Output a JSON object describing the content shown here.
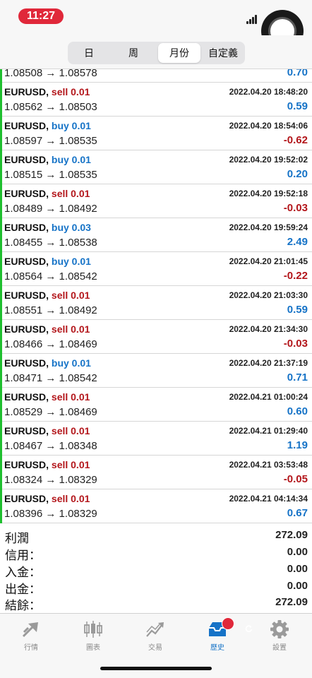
{
  "status": {
    "time": "11:27"
  },
  "segments": [
    {
      "label": "日",
      "active": false
    },
    {
      "label": "周",
      "active": false
    },
    {
      "label": "月份",
      "active": true
    },
    {
      "label": "自定義",
      "active": false
    }
  ],
  "partial_row": {
    "prices": "1.08508 → 1.08578",
    "profit": "0.70"
  },
  "deals": [
    {
      "symbol": "EURUSD,",
      "side": "sell 0.01",
      "dir": "sell",
      "date": "2022.04.20 18:48:20",
      "prices": "1.08562 → 1.08503",
      "profit": "0.59",
      "sign": "pos"
    },
    {
      "symbol": "EURUSD,",
      "side": "buy 0.01",
      "dir": "buy",
      "date": "2022.04.20 18:54:06",
      "prices": "1.08597 → 1.08535",
      "profit": "-0.62",
      "sign": "neg"
    },
    {
      "symbol": "EURUSD,",
      "side": "buy 0.01",
      "dir": "buy",
      "date": "2022.04.20 19:52:02",
      "prices": "1.08515 → 1.08535",
      "profit": "0.20",
      "sign": "pos"
    },
    {
      "symbol": "EURUSD,",
      "side": "sell 0.01",
      "dir": "sell",
      "date": "2022.04.20 19:52:18",
      "prices": "1.08489 → 1.08492",
      "profit": "-0.03",
      "sign": "neg"
    },
    {
      "symbol": "EURUSD,",
      "side": "buy 0.03",
      "dir": "buy",
      "date": "2022.04.20 19:59:24",
      "prices": "1.08455 → 1.08538",
      "profit": "2.49",
      "sign": "pos"
    },
    {
      "symbol": "EURUSD,",
      "side": "buy 0.01",
      "dir": "buy",
      "date": "2022.04.20 21:01:45",
      "prices": "1.08564 → 1.08542",
      "profit": "-0.22",
      "sign": "neg"
    },
    {
      "symbol": "EURUSD,",
      "side": "sell 0.01",
      "dir": "sell",
      "date": "2022.04.20 21:03:30",
      "prices": "1.08551 → 1.08492",
      "profit": "0.59",
      "sign": "pos"
    },
    {
      "symbol": "EURUSD,",
      "side": "sell 0.01",
      "dir": "sell",
      "date": "2022.04.20 21:34:30",
      "prices": "1.08466 → 1.08469",
      "profit": "-0.03",
      "sign": "neg"
    },
    {
      "symbol": "EURUSD,",
      "side": "buy 0.01",
      "dir": "buy",
      "date": "2022.04.20 21:37:19",
      "prices": "1.08471 → 1.08542",
      "profit": "0.71",
      "sign": "pos"
    },
    {
      "symbol": "EURUSD,",
      "side": "sell 0.01",
      "dir": "sell",
      "date": "2022.04.21 01:00:24",
      "prices": "1.08529 → 1.08469",
      "profit": "0.60",
      "sign": "pos"
    },
    {
      "symbol": "EURUSD,",
      "side": "sell 0.01",
      "dir": "sell",
      "date": "2022.04.21 01:29:40",
      "prices": "1.08467 → 1.08348",
      "profit": "1.19",
      "sign": "pos"
    },
    {
      "symbol": "EURUSD,",
      "side": "sell 0.01",
      "dir": "sell",
      "date": "2022.04.21 03:53:48",
      "prices": "1.08324 → 1.08329",
      "profit": "-0.05",
      "sign": "neg"
    },
    {
      "symbol": "EURUSD,",
      "side": "sell 0.01",
      "dir": "sell",
      "date": "2022.04.21 04:14:34",
      "prices": "1.08396 → 1.08329",
      "profit": "0.67",
      "sign": "pos"
    }
  ],
  "summary": [
    {
      "label": "利潤",
      "value": "272.09"
    },
    {
      "label": "信用：",
      "value": "0.00"
    },
    {
      "label": "入金：",
      "value": "0.00"
    },
    {
      "label": "出金：",
      "value": "0.00"
    },
    {
      "label": "結餘：",
      "value": "272.09"
    }
  ],
  "tabs": [
    {
      "label": "行情",
      "icon": "quotes-icon",
      "active": false
    },
    {
      "label": "圖表",
      "icon": "chart-icon",
      "active": false
    },
    {
      "label": "交易",
      "icon": "trade-icon",
      "active": false
    },
    {
      "label": "歷史",
      "icon": "history-icon",
      "active": true
    },
    {
      "label": "設置",
      "icon": "settings-icon",
      "active": false
    }
  ],
  "colors": {
    "sell": "#b3161b",
    "buy": "#1673c7",
    "accent_bar": "#1fbf2f",
    "badge": "#e0283a"
  }
}
